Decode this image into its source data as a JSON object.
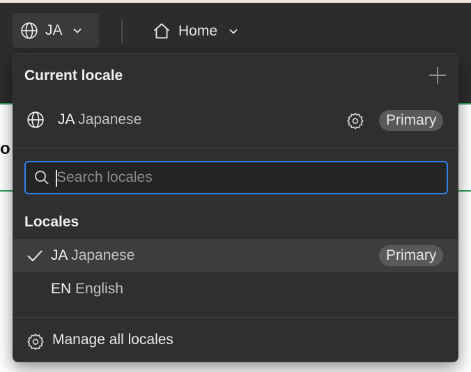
{
  "toolbar": {
    "locale_button_label": "JA",
    "home_button_label": "Home"
  },
  "dropdown": {
    "current_locale_title": "Current locale",
    "current_locale": {
      "code": "JA",
      "name": "Japanese",
      "badge": "Primary"
    },
    "search": {
      "placeholder": "Search locales",
      "value": ""
    },
    "locales_title": "Locales",
    "locales": [
      {
        "code": "JA",
        "name": "Japanese",
        "badge": "Primary",
        "selected": true
      },
      {
        "code": "EN",
        "name": "English",
        "badge": "",
        "selected": false
      }
    ],
    "manage_label": "Manage all locales"
  },
  "colors": {
    "accent": "#2f80ed",
    "panel_bg": "#2f2f2f",
    "toolbar_bg": "#2c2c2c",
    "badge_bg": "#595959",
    "green_line": "#2e9e5b"
  },
  "icons": [
    "globe-icon",
    "chevron-down-icon",
    "home-icon",
    "plus-icon",
    "gear-icon",
    "search-icon",
    "check-icon"
  ]
}
